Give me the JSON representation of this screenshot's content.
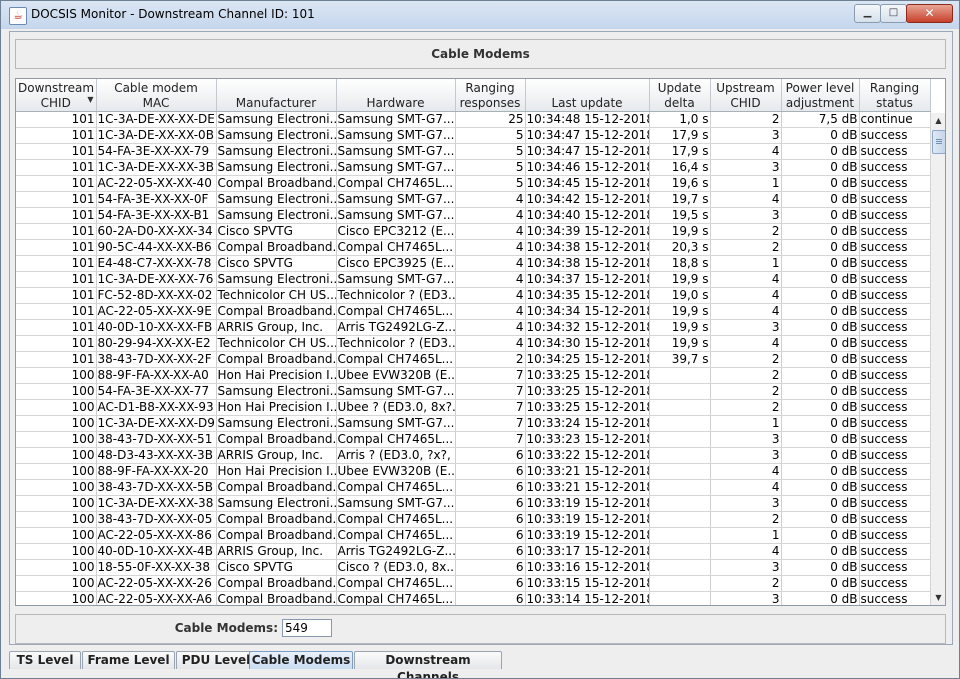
{
  "window": {
    "title": "DOCSIS Monitor - Downstream Channel ID: 101"
  },
  "panel": {
    "heading": "Cable Modems"
  },
  "table": {
    "columns": [
      {
        "line1": "Downstream",
        "line2": "CHID"
      },
      {
        "line1": "Cable modem",
        "line2": "MAC"
      },
      {
        "line1": "",
        "line2": "Manufacturer"
      },
      {
        "line1": "",
        "line2": "Hardware"
      },
      {
        "line1": "Ranging",
        "line2": "responses"
      },
      {
        "line1": "",
        "line2": "Last update"
      },
      {
        "line1": "Update",
        "line2": "delta"
      },
      {
        "line1": "Upstream",
        "line2": "CHID"
      },
      {
        "line1": "Power level",
        "line2": "adjustment"
      },
      {
        "line1": "Ranging",
        "line2": "status"
      }
    ],
    "rows": [
      [
        "101",
        "1C-3A-DE-XX-XX-DE",
        "Samsung Electroni...",
        "Samsung SMT-G7...",
        "25",
        "10:34:48  15-12-2018",
        "1,0 s",
        "2",
        "7,5 dB",
        "continue"
      ],
      [
        "101",
        "1C-3A-DE-XX-XX-0B",
        "Samsung Electroni...",
        "Samsung SMT-G7...",
        "5",
        "10:34:47  15-12-2018",
        "17,9 s",
        "3",
        "0 dB",
        "success"
      ],
      [
        "101",
        "54-FA-3E-XX-XX-79",
        "Samsung Electroni...",
        "Samsung SMT-G7...",
        "5",
        "10:34:47  15-12-2018",
        "17,9 s",
        "4",
        "0 dB",
        "success"
      ],
      [
        "101",
        "1C-3A-DE-XX-XX-3B",
        "Samsung Electroni...",
        "Samsung SMT-G7...",
        "5",
        "10:34:46  15-12-2018",
        "16,4 s",
        "3",
        "0 dB",
        "success"
      ],
      [
        "101",
        "AC-22-05-XX-XX-40",
        "Compal Broadband...",
        "Compal CH7465L...",
        "5",
        "10:34:45  15-12-2018",
        "19,6 s",
        "1",
        "0 dB",
        "success"
      ],
      [
        "101",
        "54-FA-3E-XX-XX-0F",
        "Samsung Electroni...",
        "Samsung SMT-G7...",
        "4",
        "10:34:42  15-12-2018",
        "19,7 s",
        "4",
        "0 dB",
        "success"
      ],
      [
        "101",
        "54-FA-3E-XX-XX-B1",
        "Samsung Electroni...",
        "Samsung SMT-G7...",
        "4",
        "10:34:40  15-12-2018",
        "19,5 s",
        "3",
        "0 dB",
        "success"
      ],
      [
        "101",
        "60-2A-D0-XX-XX-34",
        "Cisco SPVTG",
        "Cisco EPC3212 (E...",
        "4",
        "10:34:39  15-12-2018",
        "19,9 s",
        "2",
        "0 dB",
        "success"
      ],
      [
        "101",
        "90-5C-44-XX-XX-B6",
        "Compal Broadband...",
        "Compal CH7465L...",
        "4",
        "10:34:38  15-12-2018",
        "20,3 s",
        "2",
        "0 dB",
        "success"
      ],
      [
        "101",
        "E4-48-C7-XX-XX-78",
        "Cisco SPVTG",
        "Cisco EPC3925 (E...",
        "4",
        "10:34:38  15-12-2018",
        "18,8 s",
        "1",
        "0 dB",
        "success"
      ],
      [
        "101",
        "1C-3A-DE-XX-XX-76",
        "Samsung Electroni...",
        "Samsung SMT-G7...",
        "4",
        "10:34:37  15-12-2018",
        "19,9 s",
        "4",
        "0 dB",
        "success"
      ],
      [
        "101",
        "FC-52-8D-XX-XX-02",
        "Technicolor CH US...",
        "Technicolor ? (ED3...",
        "4",
        "10:34:35  15-12-2018",
        "19,0 s",
        "4",
        "0 dB",
        "success"
      ],
      [
        "101",
        "AC-22-05-XX-XX-9E",
        "Compal Broadband...",
        "Compal CH7465L...",
        "4",
        "10:34:34  15-12-2018",
        "19,9 s",
        "4",
        "0 dB",
        "success"
      ],
      [
        "101",
        "40-0D-10-XX-XX-FB",
        "ARRIS Group, Inc.",
        "Arris TG2492LG-Z...",
        "4",
        "10:34:32  15-12-2018",
        "19,9 s",
        "3",
        "0 dB",
        "success"
      ],
      [
        "101",
        "80-29-94-XX-XX-E2",
        "Technicolor CH US...",
        "Technicolor ? (ED3...",
        "4",
        "10:34:30  15-12-2018",
        "19,9 s",
        "4",
        "0 dB",
        "success"
      ],
      [
        "101",
        "38-43-7D-XX-XX-2F",
        "Compal Broadband...",
        "Compal CH7465L...",
        "2",
        "10:34:25  15-12-2018",
        "39,7 s",
        "2",
        "0 dB",
        "success"
      ],
      [
        "100",
        "88-9F-FA-XX-XX-A0",
        "Hon Hai Precision I...",
        "Ubee EVW320B (E...",
        "7",
        "10:33:25  15-12-2018",
        "",
        "2",
        "0 dB",
        "success"
      ],
      [
        "100",
        "54-FA-3E-XX-XX-77",
        "Samsung Electroni...",
        "Samsung SMT-G7...",
        "7",
        "10:33:25  15-12-2018",
        "",
        "2",
        "0 dB",
        "success"
      ],
      [
        "100",
        "AC-D1-B8-XX-XX-93",
        "Hon Hai Precision I...",
        "Ubee ? (ED3.0, 8x?...",
        "7",
        "10:33:25  15-12-2018",
        "",
        "2",
        "0 dB",
        "success"
      ],
      [
        "100",
        "1C-3A-DE-XX-XX-D9",
        "Samsung Electroni...",
        "Samsung SMT-G7...",
        "7",
        "10:33:24  15-12-2018",
        "",
        "1",
        "0 dB",
        "success"
      ],
      [
        "100",
        "38-43-7D-XX-XX-51",
        "Compal Broadband...",
        "Compal CH7465L...",
        "7",
        "10:33:23  15-12-2018",
        "",
        "3",
        "0 dB",
        "success"
      ],
      [
        "100",
        "48-D3-43-XX-XX-3B",
        "ARRIS Group, Inc.",
        "Arris ? (ED3.0, ?x?, ...",
        "6",
        "10:33:22  15-12-2018",
        "",
        "3",
        "0 dB",
        "success"
      ],
      [
        "100",
        "88-9F-FA-XX-XX-20",
        "Hon Hai Precision I...",
        "Ubee EVW320B (E...",
        "6",
        "10:33:21  15-12-2018",
        "",
        "4",
        "0 dB",
        "success"
      ],
      [
        "100",
        "38-43-7D-XX-XX-5B",
        "Compal Broadband...",
        "Compal CH7465L...",
        "6",
        "10:33:21  15-12-2018",
        "",
        "4",
        "0 dB",
        "success"
      ],
      [
        "100",
        "1C-3A-DE-XX-XX-38",
        "Samsung Electroni...",
        "Samsung SMT-G7...",
        "6",
        "10:33:19  15-12-2018",
        "",
        "3",
        "0 dB",
        "success"
      ],
      [
        "100",
        "38-43-7D-XX-XX-05",
        "Compal Broadband...",
        "Compal CH7465L...",
        "6",
        "10:33:19  15-12-2018",
        "",
        "2",
        "0 dB",
        "success"
      ],
      [
        "100",
        "AC-22-05-XX-XX-86",
        "Compal Broadband...",
        "Compal CH7465L...",
        "6",
        "10:33:19  15-12-2018",
        "",
        "1",
        "0 dB",
        "success"
      ],
      [
        "100",
        "40-0D-10-XX-XX-4B",
        "ARRIS Group, Inc.",
        "Arris TG2492LG-Z...",
        "6",
        "10:33:17  15-12-2018",
        "",
        "4",
        "0 dB",
        "success"
      ],
      [
        "100",
        "18-55-0F-XX-XX-38",
        "Cisco SPVTG",
        "Cisco ? (ED3.0, 8x...",
        "6",
        "10:33:16  15-12-2018",
        "",
        "3",
        "0 dB",
        "success"
      ],
      [
        "100",
        "AC-22-05-XX-XX-26",
        "Compal Broadband...",
        "Compal CH7465L...",
        "6",
        "10:33:15  15-12-2018",
        "",
        "2",
        "0 dB",
        "success"
      ],
      [
        "100",
        "AC-22-05-XX-XX-A6",
        "Compal Broadband...",
        "Compal CH7465L...",
        "6",
        "10:33:14  15-12-2018",
        "",
        "3",
        "0 dB",
        "success"
      ]
    ]
  },
  "footer": {
    "label": "Cable Modems:",
    "value": "549"
  },
  "tabs": [
    {
      "label": "TS Level"
    },
    {
      "label": "Frame Level"
    },
    {
      "label": "PDU Level"
    },
    {
      "label": "Cable Modems"
    },
    {
      "label": "Downstream Channels"
    }
  ],
  "icons": {
    "sort": "sort-descending-icon",
    "scroll_up": "scroll-up-arrow-icon",
    "scroll_down": "scroll-down-arrow-icon"
  },
  "colors": {
    "active_tab": "#c9dcf2",
    "close_button": "#c7402b"
  }
}
